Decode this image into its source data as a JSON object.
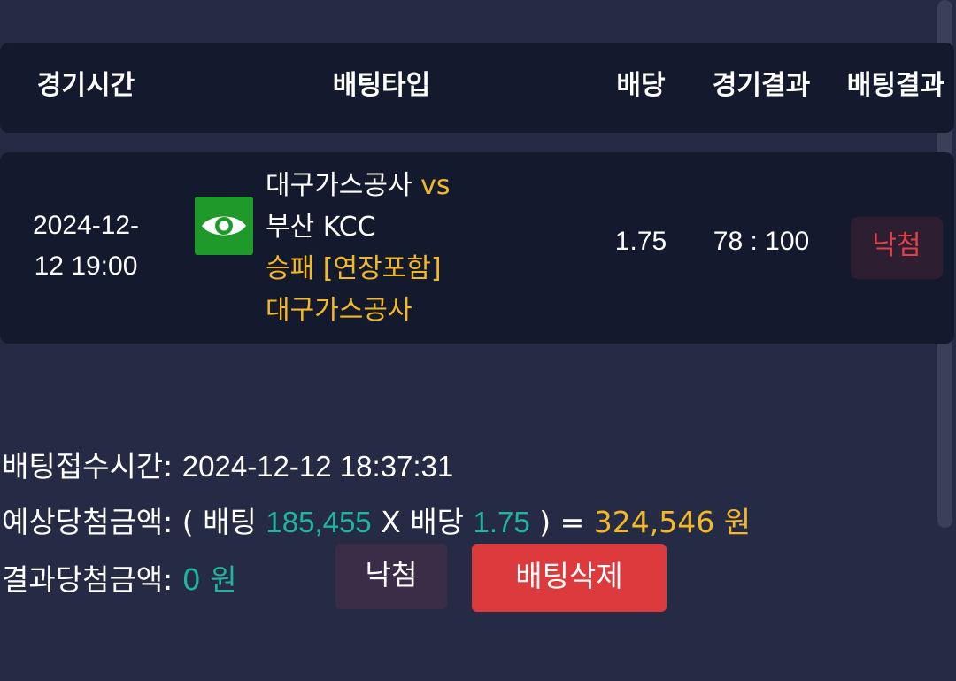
{
  "table_header": {
    "time": "경기시간",
    "bet_type": "배팅타입",
    "odds": "배당",
    "game_result": "경기결과",
    "bet_result": "배팅결과"
  },
  "bet_row": {
    "time_line1": "2024-12-",
    "time_line2": "12 19:00",
    "icon": "eye-icon",
    "home_team": "대구가스공사",
    "vs": "vs",
    "away_team": "부산 KCC",
    "market": "승패 [연장포함]",
    "pick": "대구가스공사",
    "odds": "1.75",
    "score": "78 : 100",
    "result": "낙첨"
  },
  "summary": {
    "accept_time_label": "배팅접수시간:",
    "accept_time_value": "2024-12-12 18:37:31",
    "expected_label": "예상당첨금액:",
    "expected_open": "( 배팅",
    "bet_amount": "185,455",
    "times": "X 배당",
    "odds": "1.75",
    "close_eq": ") =",
    "expected_amount": "324,546 원",
    "result_label": "결과당첨금액:",
    "result_amount": "0 원"
  },
  "buttons": {
    "lose_label": "낙첨",
    "delete_label": "배팅삭제"
  },
  "colors": {
    "background": "#262b45",
    "row_background": "#141a2e",
    "gold": "#f4b824",
    "teal": "#21b49c",
    "lose_red": "#de4249",
    "delete_button": "#dc3a3c",
    "eye_icon_bg": "#1f9a2a"
  }
}
